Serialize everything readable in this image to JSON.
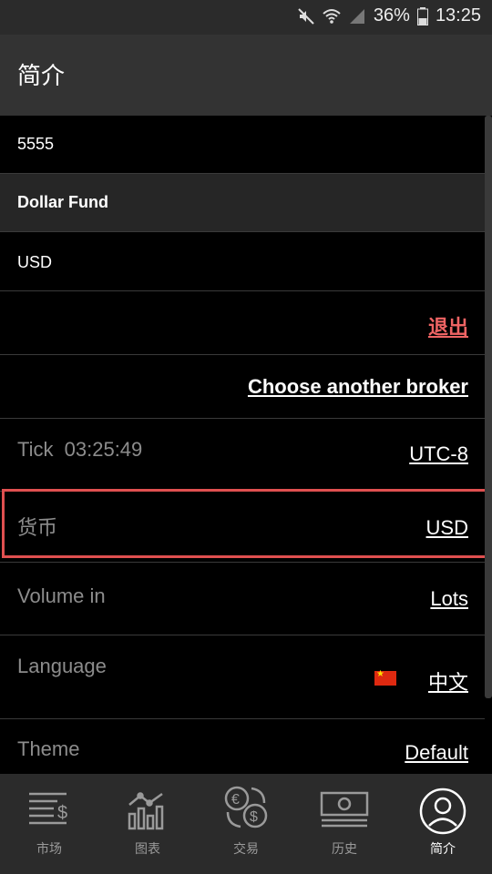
{
  "status_bar": {
    "battery": "36%",
    "time": "13:25"
  },
  "header": {
    "title": "简介"
  },
  "account": {
    "number": "5555",
    "name": "Dollar Fund",
    "currency": "USD"
  },
  "actions": {
    "logout": "退出",
    "choose_broker": "Choose another broker"
  },
  "settings": {
    "tick": {
      "label": "Tick",
      "time": "03:25:49",
      "value": "UTC-8"
    },
    "currency": {
      "label": "货币",
      "value": "USD"
    },
    "volume": {
      "label": "Volume in",
      "value": "Lots"
    },
    "language": {
      "label": "Language",
      "value": "中文"
    },
    "theme": {
      "label": "Theme",
      "value": "Default"
    }
  },
  "nav": {
    "items": [
      {
        "label": "市场",
        "icon": "market-icon"
      },
      {
        "label": "图表",
        "icon": "chart-icon"
      },
      {
        "label": "交易",
        "icon": "exchange-icon"
      },
      {
        "label": "历史",
        "icon": "history-icon"
      },
      {
        "label": "简介",
        "icon": "profile-icon",
        "active": true
      }
    ]
  },
  "colors": {
    "accent_red": "#ef6464",
    "highlight_border": "#e05050"
  }
}
